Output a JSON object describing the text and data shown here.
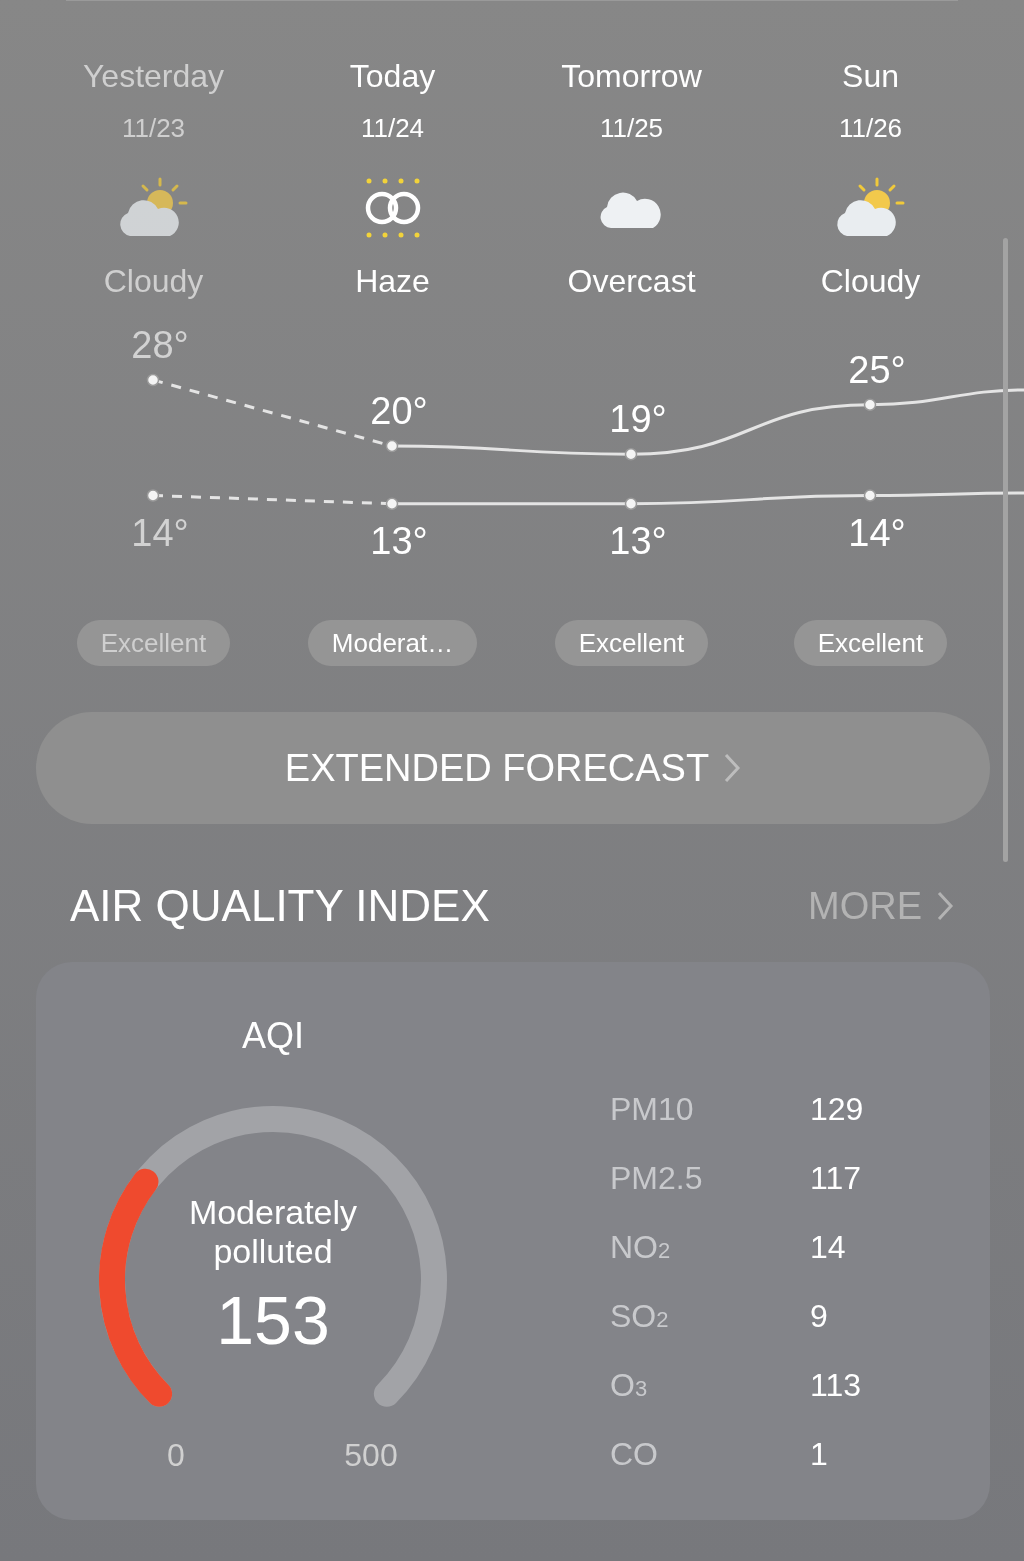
{
  "days": [
    {
      "label": "Yesterday",
      "date": "11/23",
      "kind": "partly_cloudy",
      "condition": "Cloudy",
      "high": "28°",
      "low": "14°",
      "aqi": "Excellent",
      "past": true
    },
    {
      "label": "Today",
      "date": "11/24",
      "kind": "haze",
      "condition": "Haze",
      "high": "20°",
      "low": "13°",
      "aqi": "Moderat…",
      "past": false
    },
    {
      "label": "Tomorrow",
      "date": "11/25",
      "kind": "cloudy",
      "condition": "Overcast",
      "high": "19°",
      "low": "13°",
      "aqi": "Excellent",
      "past": false
    },
    {
      "label": "Sun",
      "date": "11/26",
      "kind": "partly_cloudy",
      "condition": "Cloudy",
      "high": "25°",
      "low": "14°",
      "aqi": "Excellent",
      "past": false
    }
  ],
  "extended_button": "EXTENDED FORECAST",
  "aqi_section": {
    "title": "AIR QUALITY INDEX",
    "more": "MORE",
    "gauge": {
      "label": "AQI",
      "status": "Moderately polluted",
      "value": "153",
      "min": "0",
      "max": "500"
    },
    "pollutants": [
      {
        "name": "PM10",
        "value": "129"
      },
      {
        "name": "PM2.5",
        "value": "117"
      },
      {
        "name": "NO$_{2}$",
        "value": "14"
      },
      {
        "name": "SO$_{2}$",
        "value": "9"
      },
      {
        "name": "O$_{3}$",
        "value": "113"
      },
      {
        "name": "CO",
        "value": "1"
      }
    ]
  }
}
